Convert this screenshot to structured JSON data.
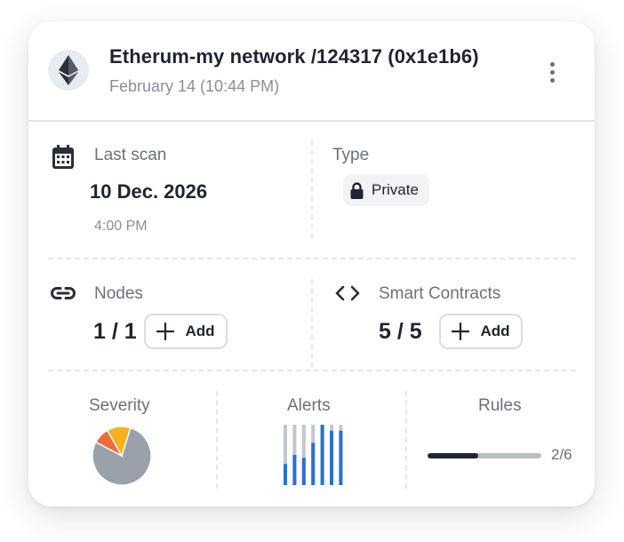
{
  "header": {
    "title": "Etherum-my network /124317 (0x1e1b6)",
    "subtitle": "February 14 (10:44 PM)",
    "avatar_icon": "ethereum-icon",
    "menu_icon": "kebab-menu-icon"
  },
  "last_scan": {
    "label": "Last scan",
    "date": "10 Dec. 2026",
    "time": "4:00 PM",
    "icon": "calendar-icon"
  },
  "type": {
    "label": "Type",
    "value": "Private",
    "icon": "lock-icon"
  },
  "nodes": {
    "label": "Nodes",
    "count": "1 / 1",
    "add_label": "Add",
    "icon": "link-icon"
  },
  "smart_contracts": {
    "label": "Smart Contracts",
    "count": "5 / 5",
    "add_label": "Add",
    "icon": "code-icon"
  },
  "severity": {
    "label": "Severity",
    "slices": [
      {
        "value": 0.78,
        "color": "#9aa1aa"
      },
      {
        "value": 0.09,
        "color": "#f06a3a"
      },
      {
        "value": 0.13,
        "color": "#f5b21b"
      }
    ]
  },
  "alerts": {
    "label": "Alerts",
    "bars": [
      0.35,
      0.5,
      0.45,
      0.7,
      1.0,
      0.9,
      0.9
    ],
    "track_color": "#c2c7ce",
    "fill_color": "#2a6fd6"
  },
  "rules": {
    "label": "Rules",
    "value_text": "2/6",
    "fraction": 0.4444
  },
  "colors": {
    "text_dark": "#1f2430",
    "text_muted": "#6b717b",
    "divider": "#dfe3e8"
  }
}
